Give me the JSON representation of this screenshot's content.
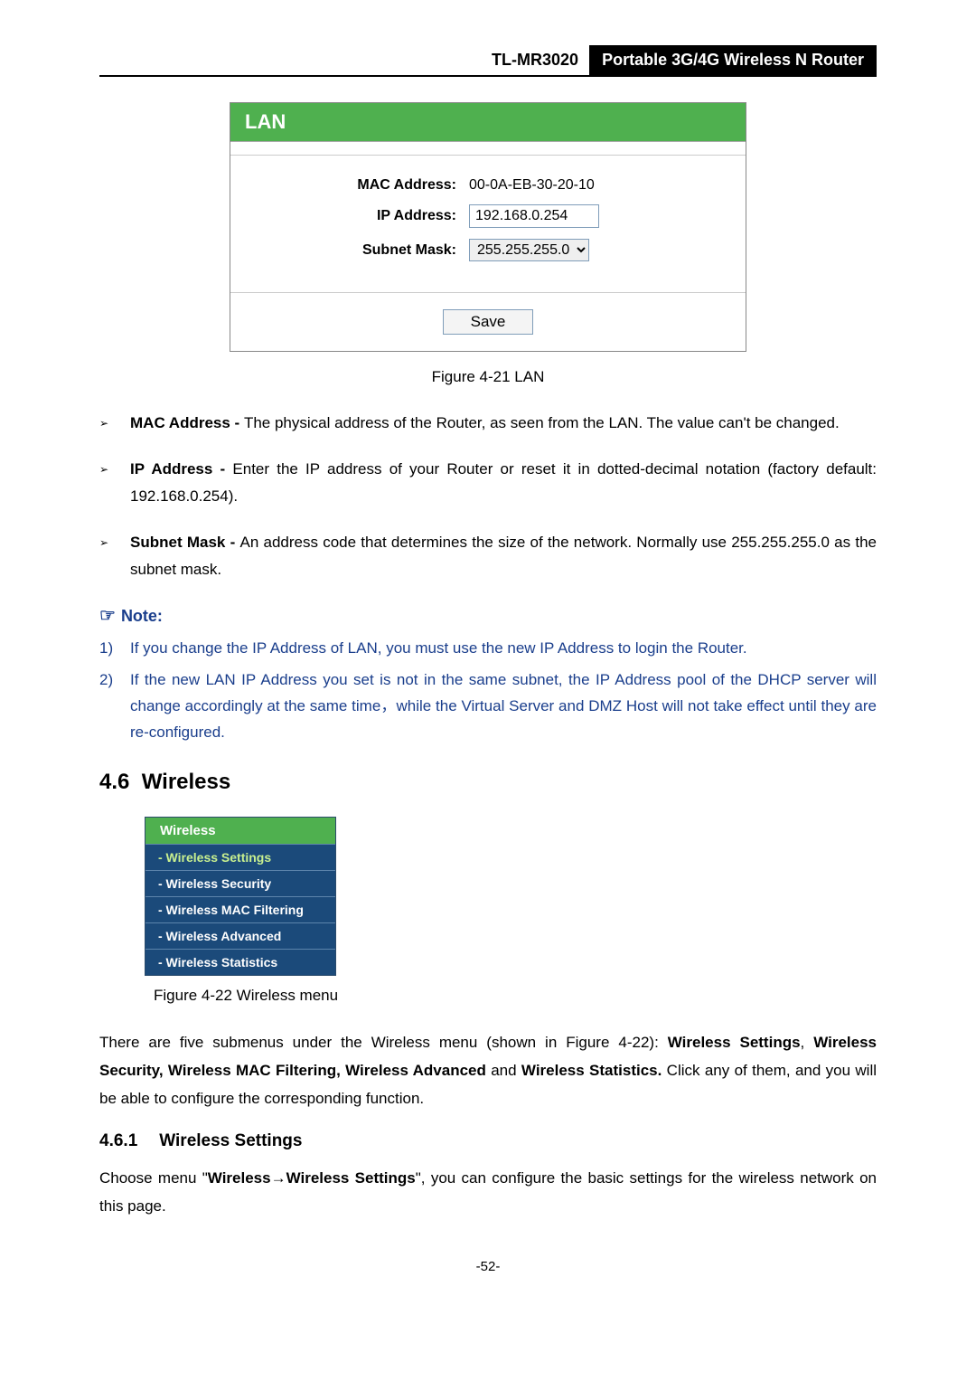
{
  "header": {
    "model": "TL-MR3020",
    "product": "Portable 3G/4G Wireless N Router"
  },
  "lan_panel": {
    "title": "LAN",
    "rows": {
      "mac_label": "MAC Address:",
      "mac_value": "00-0A-EB-30-20-10",
      "ip_label": "IP Address:",
      "ip_value": "192.168.0.254",
      "subnet_label": "Subnet Mask:",
      "subnet_value": "255.255.255.0"
    },
    "save_label": "Save"
  },
  "fig21_caption": "Figure 4-21    LAN",
  "bullets": {
    "b1_bold": "MAC Address - ",
    "b1_text": "The physical address of the Router, as seen from the LAN. The value can't be changed.",
    "b2_bold": "IP Address - ",
    "b2_text": "Enter the IP address of your Router or reset it in dotted-decimal notation (factory default: 192.168.0.254).",
    "b3_bold": "Subnet Mask - ",
    "b3_text": "An address code that determines the size of the network. Normally use 255.255.255.0 as the subnet mask."
  },
  "note": {
    "heading": "Note:",
    "n1_num": "1)",
    "n1_text": "If you change the IP Address of LAN, you must use the new IP Address to login the Router.",
    "n2_num": "2)",
    "n2_text": "If the new LAN IP Address you set is not in the same subnet, the IP Address pool of the DHCP server will change accordingly at the same time，while the Virtual Server and DMZ Host will not take effect until they are re-configured."
  },
  "section": {
    "num": "4.6",
    "title": "Wireless"
  },
  "wireless_menu": {
    "title": "Wireless",
    "items": [
      "- Wireless Settings",
      "- Wireless Security",
      "- Wireless MAC Filtering",
      "- Wireless Advanced",
      "- Wireless Statistics"
    ]
  },
  "fig22_caption": "Figure 4-22    Wireless menu",
  "para1_pre": "There are five submenus under the Wireless menu (shown in Figure 4-22): ",
  "para1_bold1": "Wireless Settings",
  "para1_mid1": ", ",
  "para1_bold2": "Wireless Security, Wireless MAC Filtering, Wireless Advanced",
  "para1_mid2": " and ",
  "para1_bold3": "Wireless Statistics.",
  "para1_post": " Click any of them, and you will be able to configure the corresponding function.",
  "subsection": {
    "num": "4.6.1",
    "title": "Wireless Settings"
  },
  "para2_pre": "Choose menu \"",
  "para2_bold1": "Wireless",
  "para2_arrow": "→",
  "para2_bold2": "Wireless Settings",
  "para2_post": "\", you can configure the basic settings for the wireless network on this page.",
  "page_number": "-52-"
}
